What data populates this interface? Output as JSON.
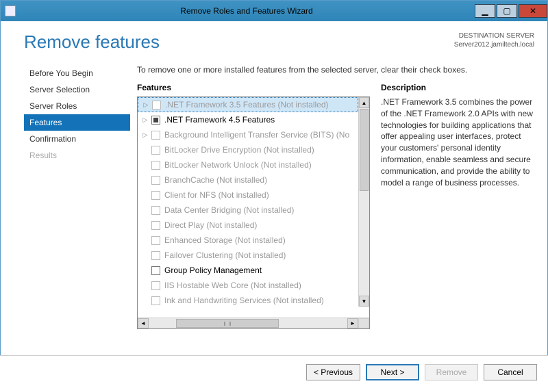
{
  "window": {
    "title": "Remove Roles and Features Wizard"
  },
  "header": {
    "page_title": "Remove features",
    "dest_label": "DESTINATION SERVER",
    "dest_value": "Server2012.jamiltech.local"
  },
  "sidebar": {
    "steps": [
      {
        "label": "Before You Begin",
        "state": "normal"
      },
      {
        "label": "Server Selection",
        "state": "normal"
      },
      {
        "label": "Server Roles",
        "state": "normal"
      },
      {
        "label": "Features",
        "state": "selected"
      },
      {
        "label": "Confirmation",
        "state": "normal"
      },
      {
        "label": "Results",
        "state": "disabled"
      }
    ]
  },
  "main": {
    "instruction": "To remove one or more installed features from the selected server, clear their check boxes.",
    "features_heading": "Features",
    "description_heading": "Description",
    "description_text": ".NET Framework 3.5 combines the power of the .NET Framework 2.0 APIs with new technologies for building applications that offer appealing user interfaces, protect your customers' personal identity information, enable seamless and secure communication, and provide the ability to model a range of business processes."
  },
  "features": [
    {
      "label": ".NET Framework 3.5 Features (Not installed)",
      "expander": "▷",
      "check": "dim",
      "selected": true,
      "dim": true
    },
    {
      "label": ".NET Framework 4.5 Features",
      "expander": "▷",
      "check": "filled",
      "selected": false,
      "dim": false
    },
    {
      "label": "Background Intelligent Transfer Service (BITS) (No",
      "expander": "▷",
      "check": "dim",
      "selected": false,
      "dim": true
    },
    {
      "label": "BitLocker Drive Encryption (Not installed)",
      "expander": "",
      "check": "dim",
      "selected": false,
      "dim": true
    },
    {
      "label": "BitLocker Network Unlock (Not installed)",
      "expander": "",
      "check": "dim",
      "selected": false,
      "dim": true
    },
    {
      "label": "BranchCache (Not installed)",
      "expander": "",
      "check": "dim",
      "selected": false,
      "dim": true
    },
    {
      "label": "Client for NFS (Not installed)",
      "expander": "",
      "check": "dim",
      "selected": false,
      "dim": true
    },
    {
      "label": "Data Center Bridging (Not installed)",
      "expander": "",
      "check": "dim",
      "selected": false,
      "dim": true
    },
    {
      "label": "Direct Play (Not installed)",
      "expander": "",
      "check": "dim",
      "selected": false,
      "dim": true
    },
    {
      "label": "Enhanced Storage (Not installed)",
      "expander": "",
      "check": "dim",
      "selected": false,
      "dim": true
    },
    {
      "label": "Failover Clustering (Not installed)",
      "expander": "",
      "check": "dim",
      "selected": false,
      "dim": true
    },
    {
      "label": "Group Policy Management",
      "expander": "",
      "check": "empty",
      "selected": false,
      "dim": false
    },
    {
      "label": "IIS Hostable Web Core (Not installed)",
      "expander": "",
      "check": "dim",
      "selected": false,
      "dim": true
    },
    {
      "label": "Ink and Handwriting Services (Not installed)",
      "expander": "",
      "check": "dim",
      "selected": false,
      "dim": true
    }
  ],
  "footer": {
    "previous": "< Previous",
    "next": "Next >",
    "remove": "Remove",
    "cancel": "Cancel"
  }
}
